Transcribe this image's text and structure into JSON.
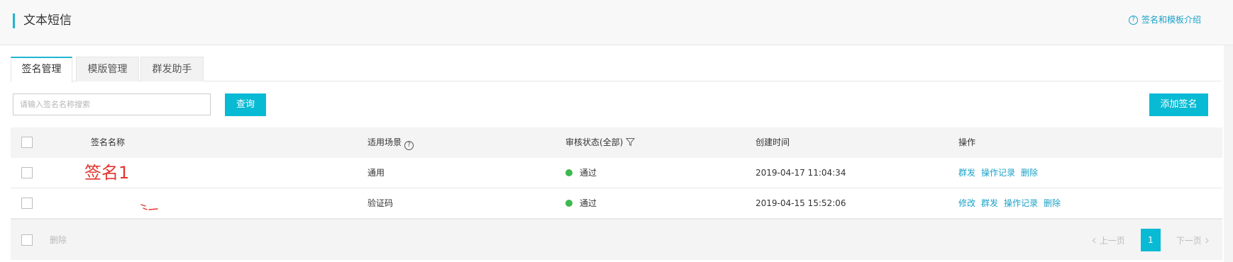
{
  "header": {
    "title": "文本短信",
    "help_link": "签名和模板介绍",
    "help_icon": "question-circle-icon",
    "accent_color": "#1fb6d2"
  },
  "tabs": [
    {
      "label": "签名管理",
      "active": true
    },
    {
      "label": "模版管理",
      "active": false
    },
    {
      "label": "群发助手",
      "active": false
    }
  ],
  "toolbar": {
    "search_placeholder": "请输入签名名称搜索",
    "search_value": "",
    "query_button": "查询",
    "add_button": "添加签名",
    "button_color": "#09bad4"
  },
  "table": {
    "columns": [
      "签名名称",
      "适用场景",
      "审核状态(全部)",
      "创建时间",
      "操作"
    ],
    "rows": [
      {
        "name": "签名1",
        "scene": "通用",
        "status": "通过",
        "status_color": "#3db84e",
        "created": "2019-04-17 11:04:34",
        "actions": [
          "群发",
          "操作记录",
          "删除"
        ]
      },
      {
        "name": "",
        "scene": "验证码",
        "status": "通过",
        "status_color": "#3db84e",
        "created": "2019-04-15 15:52:06",
        "actions": [
          "修改",
          "群发",
          "操作记录",
          "删除"
        ]
      }
    ]
  },
  "footer": {
    "delete_label": "删除",
    "prev_label": "上一页",
    "next_label": "下一页",
    "current_page": "1"
  }
}
